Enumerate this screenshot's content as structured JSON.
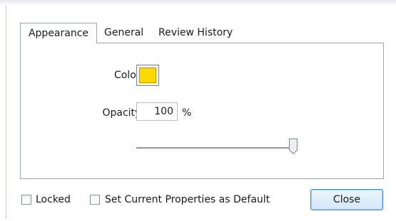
{
  "tabs": [
    {
      "label": "Appearance",
      "active": true
    },
    {
      "label": "General",
      "active": false
    },
    {
      "label": "Review History",
      "active": false
    }
  ],
  "appearance": {
    "color_label": "Color:",
    "color_value": "#ffd800",
    "opacity_label": "Opacity:",
    "opacity_value": "100",
    "opacity_unit": "%",
    "opacity_slider_fraction": 1.0
  },
  "footer": {
    "locked_label": "Locked",
    "locked_checked": false,
    "default_label": "Set Current Properties as Default",
    "default_checked": false,
    "close_label": "Close"
  }
}
